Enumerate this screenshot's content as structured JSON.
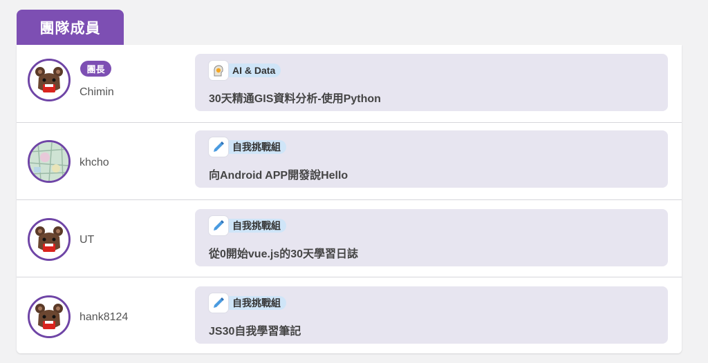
{
  "header": {
    "tab_label": "團隊成員"
  },
  "members": [
    {
      "name": "Chimin",
      "role_badge": "團長",
      "avatar_icon": "bear-avatar-icon",
      "tag_icon": "robot-head-icon",
      "category": "AI & Data",
      "article_title": "30天精通GIS資料分析-使用Python"
    },
    {
      "name": "khcho",
      "role_badge": "",
      "avatar_icon": "map-photo-avatar",
      "tag_icon": "pencil-icon",
      "category": "自我挑戰組",
      "article_title": "向Android APP開發說Hello"
    },
    {
      "name": "UT",
      "role_badge": "",
      "avatar_icon": "bear-avatar-icon",
      "tag_icon": "pencil-icon",
      "category": "自我挑戰組",
      "article_title": "從0開始vue.js的30天學習日誌"
    },
    {
      "name": "hank8124",
      "role_badge": "",
      "avatar_icon": "bear-avatar-icon",
      "tag_icon": "pencil-icon",
      "category": "自我挑戰組",
      "article_title": "JS30自我學習筆記"
    }
  ],
  "colors": {
    "accent": "#7d4fb3",
    "card_bg": "#e7e5f0",
    "tag_bg": "#cfe5f8"
  }
}
